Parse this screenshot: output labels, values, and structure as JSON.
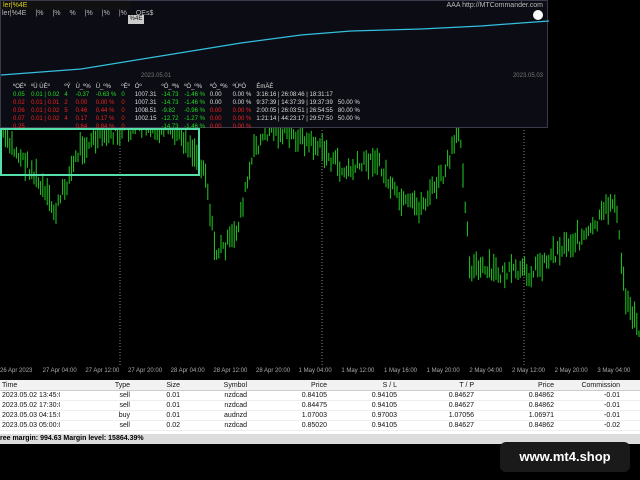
{
  "toolbar": [
    "ler|%4E",
    "|%",
    "|%",
    "%",
    "|%",
    "|%",
    "|%",
    "OEs$"
  ],
  "panel": {
    "title": "ler|%4E",
    "link": "AAA http://MTCommander.com",
    "tab": "%4E",
    "date_start": "2023.05.01",
    "date_end": "2023.05.03",
    "headers": [
      "ºOÉº",
      "ºÜ ÙÉº",
      "ºÝ",
      "Ù_º%",
      "Ù_º%",
      "ºÉº",
      "Óº",
      "ºÓ_º%",
      "ºÓ_º%",
      "ºÓ_º%",
      "ºÙºÓ",
      "ÉmÄÉ"
    ],
    "rows": [
      {
        "color": "g",
        "cells": [
          "0.05",
          "0.01 | 0.02",
          "4",
          "-0.37",
          "-0.63 %",
          "0",
          "1007.31",
          "-14.73",
          "-1.46 %",
          "0.00",
          "0.00 %",
          "3:16:16 | 26:08:46 | 18:31:17",
          ""
        ]
      },
      {
        "color": "r",
        "cells": [
          "0.02",
          "0.01 | 0.01",
          "2",
          "0.00",
          "0.00 %",
          "0",
          "1007.31",
          "-14.73",
          "-1.46 %",
          "0.00",
          "0.00 %",
          "9:37:39 | 14:37:39 | 19:37:39",
          "50.00 %"
        ]
      },
      {
        "color": "r",
        "cells": [
          "0.06",
          "0.01 | 0.02",
          "5",
          "0.46",
          "0.44 %",
          "0",
          "1008.51",
          "-9.82",
          "-0.96 %",
          "0.00",
          "0.00 %",
          "2:00:05 | 26:03:51 | 26:54:55",
          "80.00 %"
        ]
      },
      {
        "color": "r",
        "cells": [
          "0.07",
          "0.01 | 0.02",
          "4",
          "0.17",
          "0.17 %",
          "0",
          "1002.15",
          "-12.72",
          "-1.27 %",
          "0.00",
          "0.00 %",
          "1:21:14 | 44:23:17 | 29:57:50",
          "50.00 %"
        ]
      },
      {
        "color": "r",
        "cells": [
          "0.25",
          "",
          "",
          "0.84",
          "0.84 %",
          "0",
          "",
          "-14.73",
          "-1.46 %",
          "0.00",
          "0.00 %",
          "",
          ""
        ]
      }
    ]
  },
  "x_axis_labels": [
    "26 Apr 2023",
    "27 Apr 04:00",
    "27 Apr 12:00",
    "27 Apr 20:00",
    "28 Apr 04:00",
    "28 Apr 12:00",
    "28 Apr 20:00",
    "1 May 04:00",
    "1 May 12:00",
    "1 May 16:00",
    "1 May 20:00",
    "2 May 04:00",
    "2 May 12:00",
    "2 May 20:00",
    "3 May 04:00"
  ],
  "terminal": {
    "columns": [
      "Time",
      "Type",
      "Size",
      "Symbol",
      "Price",
      "S / L",
      "T / P",
      "Price",
      "Commission"
    ],
    "rows": [
      [
        "2023.05.02 13:45:01",
        "sell",
        "0.01",
        "nzdcad",
        "0.84105",
        "0.94105",
        "0.84627",
        "0.84862",
        "-0.01"
      ],
      [
        "2023.05.02 17:30:01",
        "sell",
        "0.01",
        "nzdcad",
        "0.84475",
        "0.94105",
        "0.84627",
        "0.84862",
        "-0.01"
      ],
      [
        "2023.05.03 04:15:02",
        "buy",
        "0.01",
        "audnzd",
        "1.07003",
        "0.97003",
        "1.07056",
        "1.06971",
        "-0.01"
      ],
      [
        "2023.05.03 05:00:02",
        "sell",
        "0.02",
        "nzdcad",
        "0.85020",
        "0.94105",
        "0.84627",
        "0.84862",
        "-0.02"
      ]
    ],
    "summary": "ree margin: 994.63   Margin level: 15864.39%"
  },
  "watermark": "www.mt4.shop",
  "colors": {
    "bull": "#22cc22",
    "equity_line": "#33c0e0",
    "box": "#55ddaa"
  }
}
